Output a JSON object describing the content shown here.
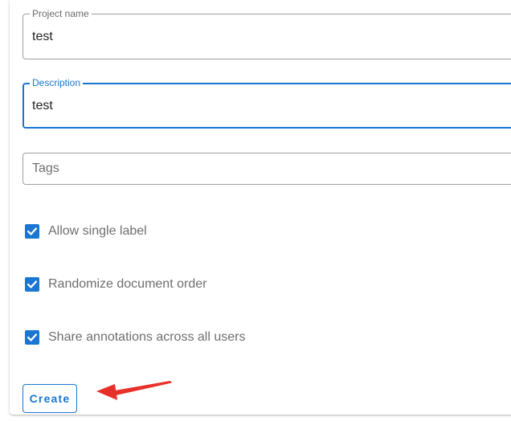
{
  "form": {
    "project_name": {
      "label": "Project name",
      "value": "test"
    },
    "description": {
      "label": "Description",
      "value": "test"
    },
    "tags": {
      "placeholder": "Tags"
    },
    "options": [
      {
        "label": "Allow single label",
        "checked": true
      },
      {
        "label": "Randomize document order",
        "checked": true
      },
      {
        "label": "Share annotations across all users",
        "checked": true
      }
    ],
    "create_label": "Create"
  },
  "colors": {
    "primary": "#1976d2",
    "annotation_arrow": "#e8302a",
    "border": "#9e9e9e"
  },
  "icons": {
    "checkbox": "check-icon",
    "annotation": "red-arrow-icon"
  }
}
